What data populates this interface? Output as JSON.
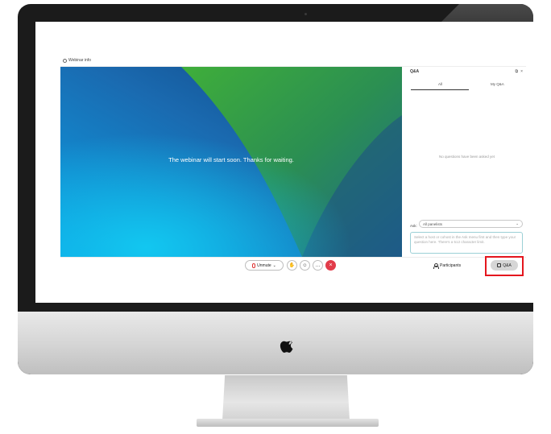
{
  "window": {
    "title": "Webinar info"
  },
  "stage": {
    "message": "The webinar will start soon. Thanks for waiting."
  },
  "qa_panel": {
    "title": "Q&A",
    "tabs": [
      {
        "label": "All",
        "active": true
      },
      {
        "label": "My Q&A",
        "active": false
      }
    ],
    "empty_message": "No questions have been asked yet",
    "ask_label": "Ask:",
    "ask_target": "All panelists",
    "input_placeholder": "Select a host or cohost in the Ask menu first and then type your question here. There's a 512 character limit."
  },
  "controls": {
    "unmute_label": "Unmute",
    "participants_label": "Participants",
    "qa_label": "Q&A"
  },
  "colors": {
    "highlight": "#e4161e",
    "leave": "#e23c4a",
    "qa_button_bg": "#d6d6d6"
  },
  "icons": {
    "window_info": "info-icon",
    "mic": "microphone-muted-icon",
    "hand": "raise-hand-icon",
    "emoji": "reaction-icon",
    "more": "more-icon",
    "leave": "close-icon",
    "participants": "person-icon",
    "qa": "qa-icon",
    "brand": "apple-logo"
  }
}
